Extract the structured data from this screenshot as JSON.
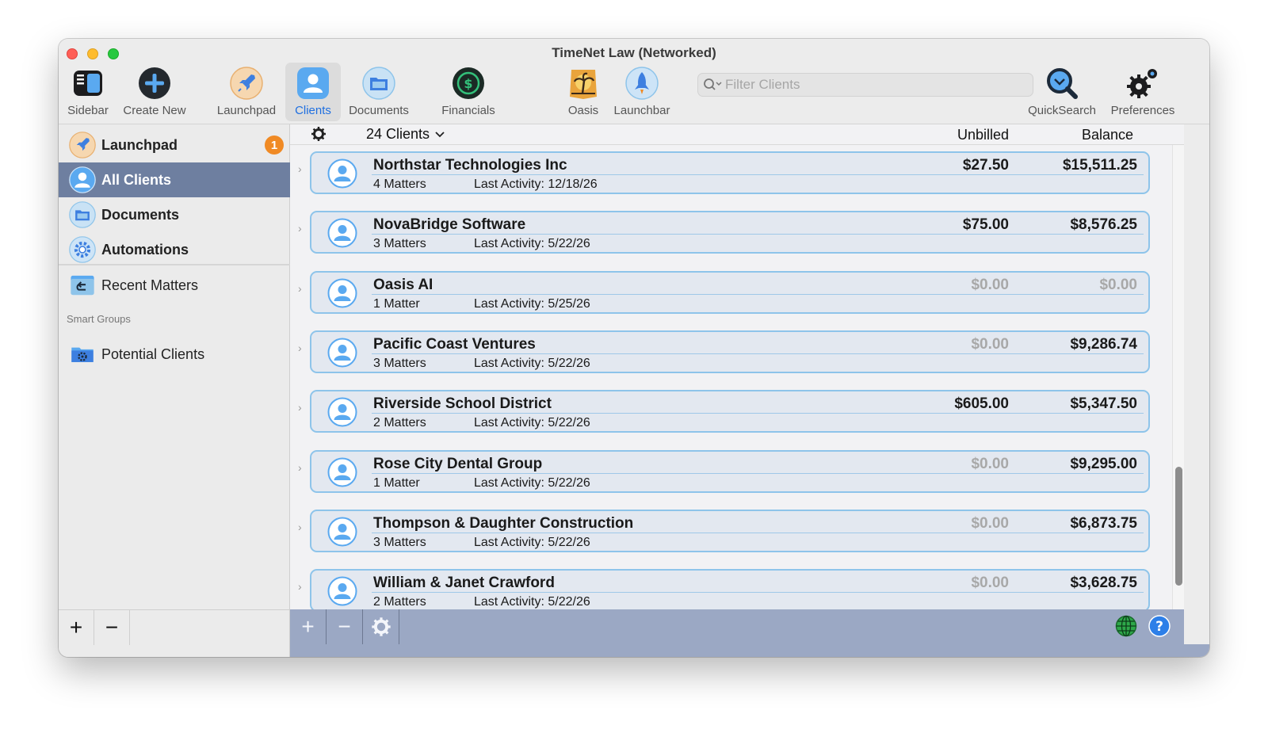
{
  "window": {
    "title": "TimeNet Law (Networked)"
  },
  "toolbar": {
    "sidebar": "Sidebar",
    "create_new": "Create New",
    "launchpad": "Launchpad",
    "clients": "Clients",
    "documents": "Documents",
    "financials": "Financials",
    "oasis": "Oasis",
    "launchbar": "Launchbar",
    "filter_placeholder": "Filter Clients",
    "quicksearch": "QuickSearch",
    "preferences": "Preferences"
  },
  "sidebar": {
    "items": [
      {
        "label": "Launchpad",
        "badge": "1"
      },
      {
        "label": "All Clients"
      },
      {
        "label": "Documents"
      },
      {
        "label": "Automations"
      },
      {
        "label": "Recent Matters"
      }
    ],
    "smart_groups_title": "Smart Groups",
    "smart_groups": [
      {
        "label": "Potential Clients"
      }
    ],
    "add_label": "+",
    "remove_label": "−"
  },
  "list": {
    "count_label": "24 Clients",
    "unbilled_header": "Unbilled",
    "balance_header": "Balance",
    "clients": [
      {
        "name": "Northstar Technologies Inc",
        "matters": "4 Matters",
        "last_activity": "Last Activity: 12/18/26",
        "unbilled": "$27.50",
        "balance": "$15,511.25"
      },
      {
        "name": "NovaBridge Software",
        "matters": "3 Matters",
        "last_activity": "Last Activity: 5/22/26",
        "unbilled": "$75.00",
        "balance": "$8,576.25"
      },
      {
        "name": "Oasis AI",
        "matters": "1 Matter",
        "last_activity": "Last Activity: 5/25/26",
        "unbilled": "$0.00",
        "balance": "$0.00"
      },
      {
        "name": "Pacific Coast Ventures",
        "matters": "3 Matters",
        "last_activity": "Last Activity: 5/22/26",
        "unbilled": "$0.00",
        "balance": "$9,286.74"
      },
      {
        "name": "Riverside School District",
        "matters": "2 Matters",
        "last_activity": "Last Activity: 5/22/26",
        "unbilled": "$605.00",
        "balance": "$5,347.50"
      },
      {
        "name": "Rose City Dental Group",
        "matters": "1 Matter",
        "last_activity": "Last Activity: 5/22/26",
        "unbilled": "$0.00",
        "balance": "$9,295.00"
      },
      {
        "name": "Thompson & Daughter Construction",
        "matters": "3 Matters",
        "last_activity": "Last Activity: 5/22/26",
        "unbilled": "$0.00",
        "balance": "$6,873.75"
      },
      {
        "name": "William & Janet Crawford",
        "matters": "2 Matters",
        "last_activity": "Last Activity: 5/22/26",
        "unbilled": "$0.00",
        "balance": "$3,628.75"
      }
    ]
  },
  "bottom_bar": {
    "add_label": "+",
    "remove_label": "−"
  },
  "colors": {
    "accent": "#1f6fe0",
    "selection": "#6e7fa0",
    "card_border": "#8ec4ea",
    "badge": "#f08a24",
    "bottom_bar": "#9ba8c4"
  }
}
